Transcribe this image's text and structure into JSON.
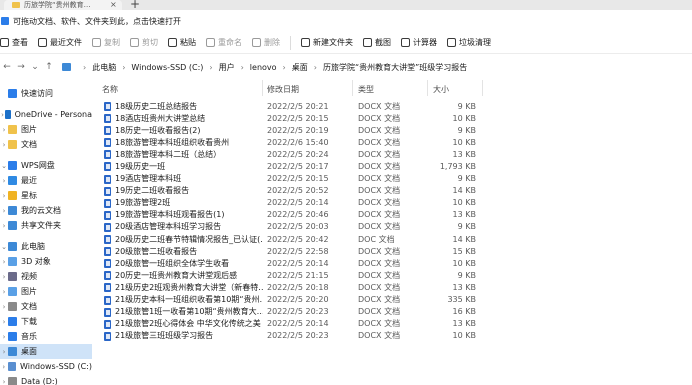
{
  "window": {
    "tab_title": "历旅学院“贵州教育…"
  },
  "infobar": {
    "text": "可拖动文档、软件、文件夹到此，点击快速打开"
  },
  "commands": [
    {
      "label": "查看",
      "icon": "view-icon",
      "enabled": true
    },
    {
      "label": "最近文件",
      "icon": "recent-icon",
      "enabled": true
    },
    {
      "label": "复制",
      "icon": "copy-icon",
      "enabled": false
    },
    {
      "label": "剪切",
      "icon": "cut-icon",
      "enabled": false
    },
    {
      "label": "粘贴",
      "icon": "paste-icon",
      "enabled": true
    },
    {
      "label": "重命名",
      "icon": "rename-icon",
      "enabled": false
    },
    {
      "label": "删除",
      "icon": "delete-icon",
      "enabled": false
    },
    {
      "label": "新建文件夹",
      "icon": "new-folder-icon",
      "enabled": true
    },
    {
      "label": "截图",
      "icon": "screenshot-icon",
      "enabled": true
    },
    {
      "label": "计算器",
      "icon": "calculator-icon",
      "enabled": true
    },
    {
      "label": "垃圾清理",
      "icon": "cleanup-icon",
      "enabled": true
    }
  ],
  "breadcrumb": [
    "此电脑",
    "Windows-SSD (C:)",
    "用户",
    "lenovo",
    "桌面",
    "历旅学院“贵州教育大讲堂”班级学习报告"
  ],
  "sidebar": {
    "items": [
      {
        "label": "快速访问",
        "icon": "star-icon",
        "color": "#2b7de9",
        "expand": ""
      },
      {
        "label": "OneDrive - Persona",
        "icon": "cloud-icon",
        "color": "#1c70c9",
        "expand": "›"
      },
      {
        "label": "图片",
        "icon": "folder-icon",
        "color": "#f0c24b",
        "expand": "›"
      },
      {
        "label": "文档",
        "icon": "folder-icon",
        "color": "#f0c24b",
        "expand": "›"
      },
      {
        "label": "WPS网盘",
        "icon": "cloud-icon",
        "color": "#2b7de9",
        "expand": "⌄"
      },
      {
        "label": "最近",
        "icon": "recent-icon",
        "color": "#2f8ae3",
        "expand": "›"
      },
      {
        "label": "星标",
        "icon": "star-icon",
        "color": "#f0b323",
        "expand": "›"
      },
      {
        "label": "我的云文档",
        "icon": "cloud-icon",
        "color": "#3d89d6",
        "expand": "›"
      },
      {
        "label": "共享文件夹",
        "icon": "shared-folder-icon",
        "color": "#3d89d6",
        "expand": "›"
      },
      {
        "label": "此电脑",
        "icon": "pc-icon",
        "color": "#3d89d6",
        "expand": "⌄"
      },
      {
        "label": "3D 对象",
        "icon": "cube-icon",
        "color": "#5aa0e6",
        "expand": "›"
      },
      {
        "label": "视频",
        "icon": "video-icon",
        "color": "#6b6b8a",
        "expand": "›"
      },
      {
        "label": "图片",
        "icon": "picture-icon",
        "color": "#5aa0e6",
        "expand": "›"
      },
      {
        "label": "文档",
        "icon": "document-icon",
        "color": "#8a8a8a",
        "expand": "›"
      },
      {
        "label": "下载",
        "icon": "download-icon",
        "color": "#2b7de9",
        "expand": "›"
      },
      {
        "label": "音乐",
        "icon": "music-icon",
        "color": "#2b7de9",
        "expand": "›"
      },
      {
        "label": "桌面",
        "icon": "desktop-icon",
        "color": "#3d89d6",
        "expand": "›"
      },
      {
        "label": "Windows-SSD (C:)",
        "icon": "drive-icon",
        "color": "#5a8fd0",
        "expand": "›"
      },
      {
        "label": "Data (D:)",
        "icon": "drive-icon",
        "color": "#8a8a8a",
        "expand": "›"
      }
    ]
  },
  "columns": {
    "name": "名称",
    "date": "修改日期",
    "type": "类型",
    "size": "大小"
  },
  "files": [
    {
      "name": "18级历史二班总结报告",
      "date": "2022/2/5 20:21",
      "type": "DOCX 文档",
      "size": "9 KB"
    },
    {
      "name": "18酒店班贵州大讲堂总结",
      "date": "2022/2/5 20:15",
      "type": "DOCX 文档",
      "size": "10 KB"
    },
    {
      "name": "18历史一班收看报告(2)",
      "date": "2022/2/5 20:19",
      "type": "DOCX 文档",
      "size": "9 KB"
    },
    {
      "name": "18旅游管理本科班组织收看贵州",
      "date": "2022/2/6 15:40",
      "type": "DOCX 文档",
      "size": "10 KB"
    },
    {
      "name": "18旅游管理本科二班（总结）",
      "date": "2022/2/5 20:24",
      "type": "DOCX 文档",
      "size": "13 KB"
    },
    {
      "name": "19级历史一班",
      "date": "2022/2/5 20:17",
      "type": "DOCX 文档",
      "size": "1,793 KB"
    },
    {
      "name": "19酒店管理本科班",
      "date": "2022/2/5 20:15",
      "type": "DOCX 文档",
      "size": "9 KB"
    },
    {
      "name": "19历史二班收看报告",
      "date": "2022/2/5 20:52",
      "type": "DOCX 文档",
      "size": "14 KB"
    },
    {
      "name": "19旅游管理2班",
      "date": "2022/2/5 20:14",
      "type": "DOCX 文档",
      "size": "10 KB"
    },
    {
      "name": "19旅游管理本科班观看报告(1)",
      "date": "2022/2/5 20:46",
      "type": "DOCX 文档",
      "size": "13 KB"
    },
    {
      "name": "20级酒店管理本科班学习报告",
      "date": "2022/2/5 20:03",
      "type": "DOCX 文档",
      "size": "9 KB"
    },
    {
      "name": "20级历史二班春节特辑情况报告_已认证(…",
      "date": "2022/2/5 20:42",
      "type": "DOC 文档",
      "size": "14 KB"
    },
    {
      "name": "20级旅管二班收看报告",
      "date": "2022/2/5 22:58",
      "type": "DOCX 文档",
      "size": "15 KB"
    },
    {
      "name": "20级旅管一班组织全体学生收看",
      "date": "2022/2/5 20:14",
      "type": "DOCX 文档",
      "size": "10 KB"
    },
    {
      "name": "20历史一班贵州教育大讲堂观后感",
      "date": "2022/2/5 21:15",
      "type": "DOCX 文档",
      "size": "9 KB"
    },
    {
      "name": "21级历史2班观贵州教育大讲堂（新春特…",
      "date": "2022/2/5 20:18",
      "type": "DOCX 文档",
      "size": "13 KB"
    },
    {
      "name": "21级历史本科一班组织收看第10期“贵州…",
      "date": "2022/2/5 20:20",
      "type": "DOCX 文档",
      "size": "335 KB"
    },
    {
      "name": "21级旅管1班一收看第10期“贵州教育大…",
      "date": "2022/2/5 20:23",
      "type": "DOCX 文档",
      "size": "16 KB"
    },
    {
      "name": "21级旅管2班心得体会 中华文化传统之美",
      "date": "2022/2/5 20:14",
      "type": "DOCX 文档",
      "size": "13 KB"
    },
    {
      "name": "21级旅管三班班级学习报告",
      "date": "2022/2/5 20:23",
      "type": "DOCX 文档",
      "size": "10 KB"
    }
  ]
}
